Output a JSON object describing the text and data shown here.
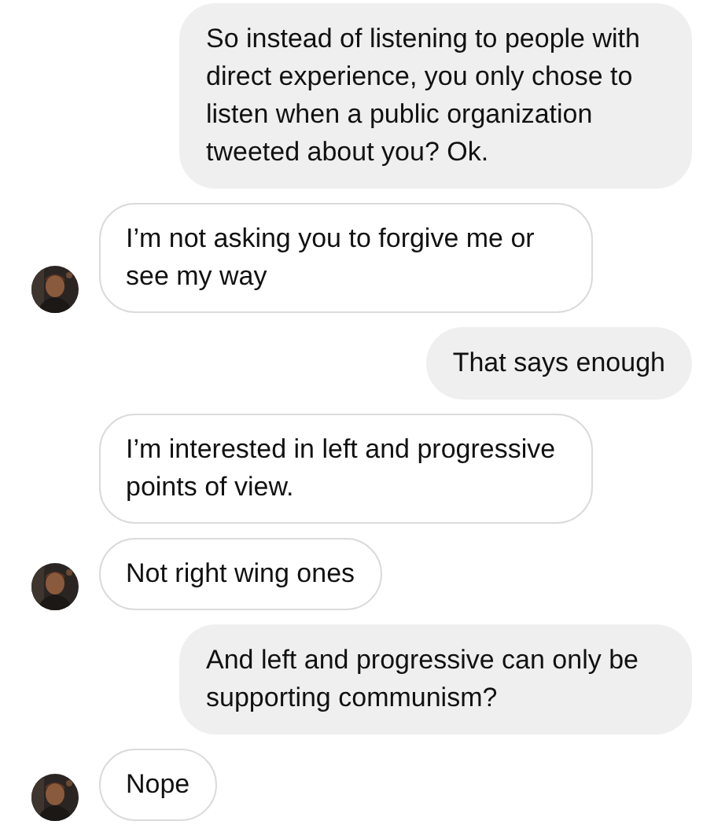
{
  "messages": [
    {
      "kind": "sent",
      "text": "So instead of listening to people with direct experience, you only chose to listen when a public organization tweeted about you? Ok."
    },
    {
      "kind": "received",
      "text": "I’m not asking you to forgive me or see my way",
      "avatar": true
    },
    {
      "kind": "sent",
      "text": "That says enough"
    },
    {
      "kind": "received",
      "text": "I’m interested in left and progressive points of view.",
      "avatar": false
    },
    {
      "kind": "received",
      "text": "Not right wing ones",
      "avatar": true
    },
    {
      "kind": "sent",
      "text": "And left and progressive can only be supporting communism?"
    },
    {
      "kind": "received",
      "text": "Nope",
      "avatar": true
    }
  ]
}
